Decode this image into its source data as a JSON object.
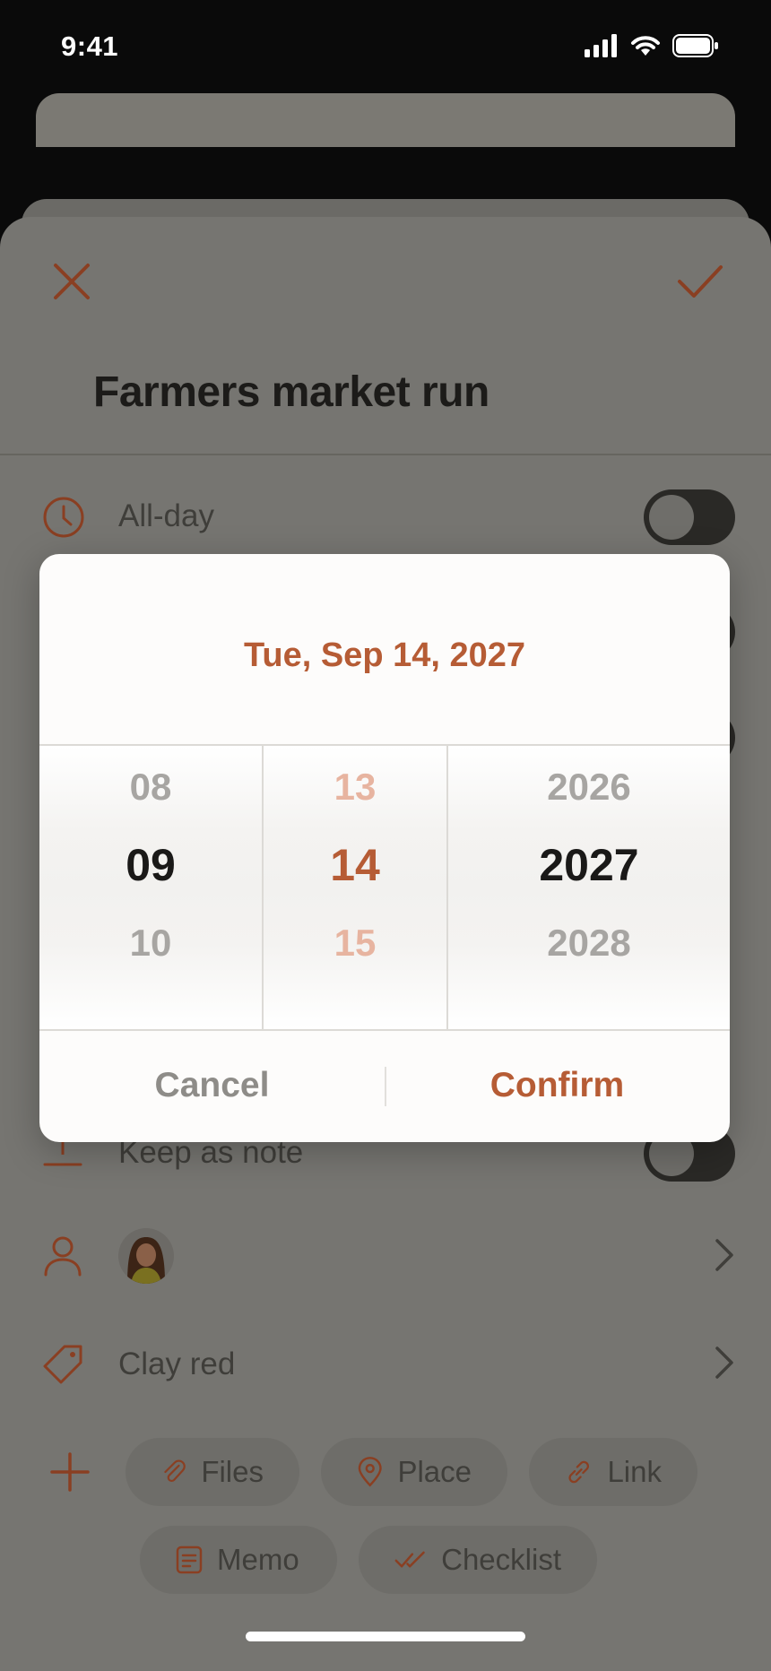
{
  "status_bar": {
    "time": "9:41"
  },
  "event": {
    "title": "Farmers market run"
  },
  "rows": {
    "all_day_label": "All-day",
    "keep_as_note_label": "Keep as note",
    "color_label": "Clay red"
  },
  "attachments": {
    "files": "Files",
    "place": "Place",
    "link": "Link",
    "memo": "Memo",
    "checklist": "Checklist"
  },
  "date_picker": {
    "header": "Tue, Sep 14, 2027",
    "month": {
      "prev": "08",
      "selected": "09",
      "next": "10"
    },
    "day": {
      "prev": "13",
      "selected": "14",
      "next": "15"
    },
    "year": {
      "prev": "2026",
      "selected": "2027",
      "next": "2028"
    },
    "cancel_label": "Cancel",
    "confirm_label": "Confirm"
  },
  "colors": {
    "accent": "#b65c35",
    "accent_light": "#e7b4a0",
    "scrim": "#767571"
  },
  "icons": [
    "close-icon",
    "check-icon",
    "clock-icon",
    "pin-icon",
    "person-icon",
    "tag-icon",
    "chevron-right-icon",
    "plus-icon",
    "paperclip-icon",
    "map-pin-icon",
    "link-icon",
    "note-icon",
    "double-check-icon"
  ]
}
